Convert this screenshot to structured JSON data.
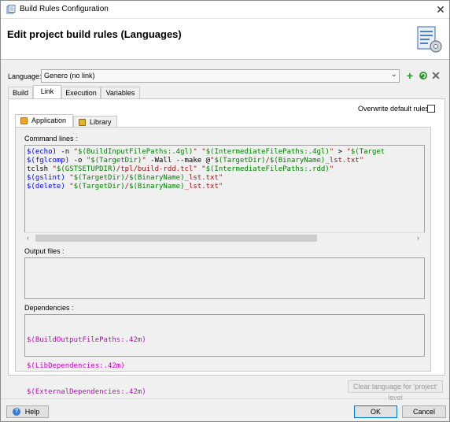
{
  "window": {
    "title": "Build Rules Configuration",
    "close_icon": "close-icon"
  },
  "header": {
    "title": "Edit project build rules (Languages)",
    "icon": "settings-document-icon"
  },
  "language": {
    "label": "Language:",
    "selected": "Genero (no link)",
    "actions": [
      {
        "name": "add-language-button",
        "icon": "plus-icon",
        "color": "#1e9e1e"
      },
      {
        "name": "refresh-language-button",
        "icon": "refresh-icon",
        "color": "#1e9e1e"
      },
      {
        "name": "delete-language-button",
        "icon": "x-icon",
        "color": "#666666"
      }
    ]
  },
  "tabs": [
    "Build",
    "Link",
    "Execution",
    "Variables"
  ],
  "active_tab": "Link",
  "overwrite_default": {
    "label": "Overwrite default rules",
    "checked": false
  },
  "subtabs": [
    {
      "label": "Application",
      "icon": "application-icon"
    },
    {
      "label": "Library",
      "icon": "library-icon"
    }
  ],
  "active_subtab": "Application",
  "command_lines": {
    "label": "Command lines :",
    "lines": [
      [
        {
          "t": "$(echo)",
          "c": "kw"
        },
        {
          "t": " -n ",
          "c": "plain"
        },
        {
          "t": "\"",
          "c": "red"
        },
        {
          "t": "$(BuildInputFilePaths:.4gl)",
          "c": "str"
        },
        {
          "t": "\" \"",
          "c": "red"
        },
        {
          "t": "$(IntermediateFilePaths:.4gl)",
          "c": "str"
        },
        {
          "t": "\"",
          "c": "red"
        },
        {
          "t": " > ",
          "c": "plain"
        },
        {
          "t": "\"",
          "c": "red"
        },
        {
          "t": "$(Target",
          "c": "str"
        }
      ],
      [
        {
          "t": "$(fglcomp)",
          "c": "kw"
        },
        {
          "t": " -o ",
          "c": "plain"
        },
        {
          "t": "\"",
          "c": "red"
        },
        {
          "t": "$(TargetDir)",
          "c": "str"
        },
        {
          "t": "\"",
          "c": "red"
        },
        {
          "t": " -Wall --make @",
          "c": "plain"
        },
        {
          "t": "\"",
          "c": "red"
        },
        {
          "t": "$(TargetDir)",
          "c": "str"
        },
        {
          "t": "/",
          "c": "red"
        },
        {
          "t": "$(BinaryName)",
          "c": "str"
        },
        {
          "t": "_lst.txt\"",
          "c": "red"
        }
      ],
      [
        {
          "t": "tclsh ",
          "c": "plain"
        },
        {
          "t": "\"",
          "c": "red"
        },
        {
          "t": "$(GSTSETUPDIR)",
          "c": "str"
        },
        {
          "t": "/tpl/build-rdd.tcl\"",
          "c": "red"
        },
        {
          "t": " ",
          "c": "plain"
        },
        {
          "t": "\"",
          "c": "red"
        },
        {
          "t": "$(IntermediateFilePaths:.rdd)",
          "c": "str"
        },
        {
          "t": "\"",
          "c": "red"
        }
      ],
      [
        {
          "t": "$(gslint)",
          "c": "kw"
        },
        {
          "t": " ",
          "c": "plain"
        },
        {
          "t": "\"",
          "c": "red"
        },
        {
          "t": "$(TargetDir)",
          "c": "str"
        },
        {
          "t": "/",
          "c": "red"
        },
        {
          "t": "$(BinaryName)",
          "c": "str"
        },
        {
          "t": "_lst.txt\"",
          "c": "red"
        }
      ],
      [
        {
          "t": "$(delete)",
          "c": "kw"
        },
        {
          "t": " ",
          "c": "plain"
        },
        {
          "t": "\"",
          "c": "red"
        },
        {
          "t": "$(TargetDir)",
          "c": "str"
        },
        {
          "t": "/",
          "c": "red"
        },
        {
          "t": "$(BinaryName)",
          "c": "str"
        },
        {
          "t": "_lst.txt\"",
          "c": "red"
        }
      ]
    ]
  },
  "output_files": {
    "label": "Output files :",
    "lines": []
  },
  "dependencies": {
    "label": "Dependencies :",
    "lines": [
      "$(BuildOutputFilePaths:.42m)",
      "$(LibDependencies:.42m)",
      "$(ExternalDependencies:.42m)"
    ]
  },
  "clear_button": "Clear language for 'project' level",
  "help_button": "Help",
  "ok_button": "OK",
  "cancel_button": "Cancel",
  "colors": {
    "keyword": "#0000ff",
    "variable": "#008000",
    "string": "#a31515",
    "dependency": "#c800c8"
  }
}
